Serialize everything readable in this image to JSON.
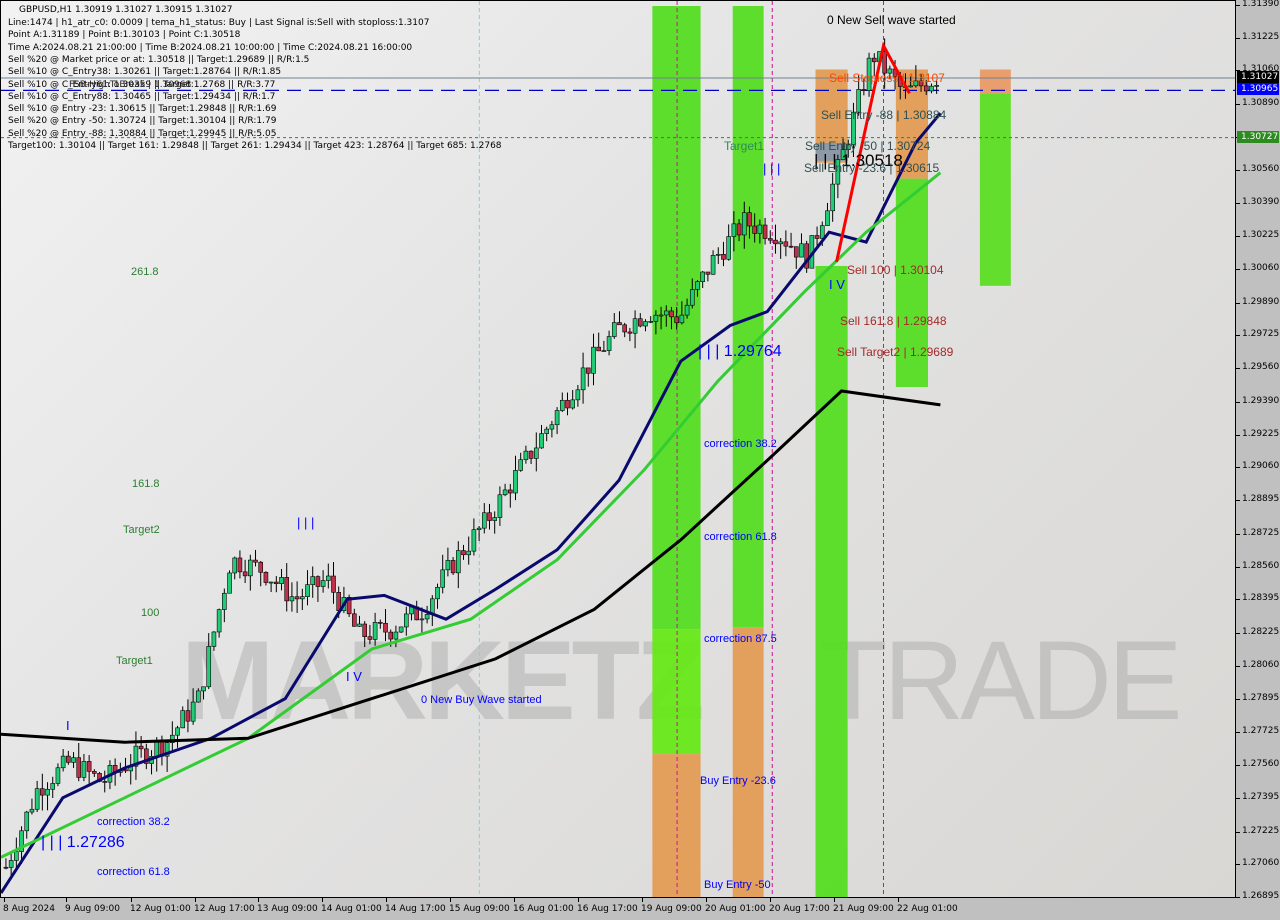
{
  "header": {
    "symbol_line": "GBPUSD,H1  1.30919 1.31027 1.30915 1.31027",
    "info_lines": [
      "Line:1474 | h1_atr_c0: 0.0009 | tema_h1_status: Buy | Last Signal is:Sell with stoploss:1.3107",
      "Point A:1.31189 | Point B:1.30103 | Point C:1.30518",
      "Time A:2024.08.21 21:00:00 | Time B:2024.08.21 10:00:00 | Time C:2024.08.21 16:00:00",
      "Sell %20 @ Market price or at: 1.30518 || Target:1.29689 || R/R:1.5",
      "Sell %10 @ C_Entry38: 1.30261 || Target:1.28764 || R/R:1.85",
      "Sell %10 @ C_Entry61: 1.30359 || Target:1.2768 || R/R:3.77",
      "Sell %10 @ C_Entry88: 1.30465 || Target:1.29434 || R/R:1.7",
      "Sell %10 @ Entry -23: 1.30615 || Target:1.29848 || R/R:1.69",
      "Sell %20 @ Entry -50: 1.30724 || Target:1.30104 || R/R:1.79",
      "Sell %20 @ Entry -88: 1.30884 || Target:1.29945 || R/R:5.05",
      "Target100: 1.30104 || Target 161: 1.29848 || Target 261: 1.29434 || Target 423: 1.28764 || Target 685: 1.2768"
    ],
    "overlay_text": "FSB-HighToBreak | 1.30968"
  },
  "watermark": {
    "left": "MARKETZ",
    "right": "TRADE"
  },
  "chart_data": {
    "type": "candlestick",
    "title": "GBPUSD,H1",
    "ohlc_last": {
      "open": 1.30919,
      "high": 1.31027,
      "low": 1.30915,
      "close": 1.31027
    },
    "ylim": [
      1.26895,
      1.3139
    ],
    "y_ticks": [
      "1.31390",
      "1.31225",
      "1.31060",
      "1.30890",
      "1.30727",
      "1.30560",
      "1.30390",
      "1.30225",
      "1.30060",
      "1.29890",
      "1.29725",
      "1.29560",
      "1.29390",
      "1.29225",
      "1.29060",
      "1.28895",
      "1.28725",
      "1.28560",
      "1.28395",
      "1.28225",
      "1.28060",
      "1.27895",
      "1.27725",
      "1.27560",
      "1.27395",
      "1.27225",
      "1.27060",
      "1.26895"
    ],
    "x_ticks": [
      "8 Aug 2024",
      "9 Aug 09:00",
      "12 Aug 01:00",
      "12 Aug 17:00",
      "13 Aug 09:00",
      "14 Aug 01:00",
      "14 Aug 17:00",
      "15 Aug 09:00",
      "16 Aug 01:00",
      "16 Aug 17:00",
      "19 Aug 09:00",
      "20 Aug 01:00",
      "20 Aug 17:00",
      "21 Aug 09:00",
      "22 Aug 01:00"
    ],
    "price_badges": [
      {
        "label": "1.31027",
        "value": 1.31027,
        "color": "#000000"
      },
      {
        "label": "1.30965",
        "value": 1.30965,
        "color": "#0000ff"
      },
      {
        "label": "1.30727",
        "value": 1.30727,
        "color": "#2e8b22"
      }
    ],
    "horizontal_lines": [
      {
        "name": "current-price",
        "value": 1.31027,
        "color": "#708090",
        "style": "solid"
      },
      {
        "name": "fsb-high-to-break",
        "value": 1.30965,
        "color": "#0000cc",
        "style": "dashed"
      },
      {
        "name": "level-130727",
        "value": 1.30727,
        "color": "#2e8b22",
        "style": "dotted"
      }
    ],
    "close_series_approx": [
      {
        "t": "8 Aug 2024",
        "v": 1.2705
      },
      {
        "t": "8 Aug 12:00",
        "v": 1.2745
      },
      {
        "t": "9 Aug 09:00",
        "v": 1.2758
      },
      {
        "t": "9 Aug 15:00",
        "v": 1.2748
      },
      {
        "t": "12 Aug 01:00",
        "v": 1.276
      },
      {
        "t": "12 Aug 17:00",
        "v": 1.2768
      },
      {
        "t": "13 Aug 01:00",
        "v": 1.279
      },
      {
        "t": "13 Aug 09:00",
        "v": 1.286
      },
      {
        "t": "13 Aug 17:00",
        "v": 1.2855
      },
      {
        "t": "14 Aug 01:00",
        "v": 1.284
      },
      {
        "t": "14 Aug 09:00",
        "v": 1.285
      },
      {
        "t": "14 Aug 17:00",
        "v": 1.2822
      },
      {
        "t": "15 Aug 01:00",
        "v": 1.2825
      },
      {
        "t": "15 Aug 09:00",
        "v": 1.2835
      },
      {
        "t": "15 Aug 17:00",
        "v": 1.286
      },
      {
        "t": "16 Aug 01:00",
        "v": 1.288
      },
      {
        "t": "16 Aug 09:00",
        "v": 1.2905
      },
      {
        "t": "16 Aug 17:00",
        "v": 1.293
      },
      {
        "t": "19 Aug 01:00",
        "v": 1.2955
      },
      {
        "t": "19 Aug 09:00",
        "v": 1.2975
      },
      {
        "t": "19 Aug 17:00",
        "v": 1.2985
      },
      {
        "t": "20 Aug 01:00",
        "v": 1.2982
      },
      {
        "t": "20 Aug 09:00",
        "v": 1.301
      },
      {
        "t": "20 Aug 17:00",
        "v": 1.303
      },
      {
        "t": "21 Aug 01:00",
        "v": 1.3025
      },
      {
        "t": "21 Aug 09:00",
        "v": 1.3012
      },
      {
        "t": "21 Aug 15:00",
        "v": 1.306
      },
      {
        "t": "21 Aug 21:00",
        "v": 1.3115
      },
      {
        "t": "22 Aug 01:00",
        "v": 1.3095
      },
      {
        "t": "22 Aug 05:00",
        "v": 1.3103
      }
    ],
    "ma_series": [
      {
        "name": "ma-fast-navy",
        "color": "#0a0a6e",
        "points": [
          [
            0,
            1.2692
          ],
          [
            0.05,
            1.274
          ],
          [
            0.1,
            1.2755
          ],
          [
            0.17,
            1.277
          ],
          [
            0.23,
            1.279
          ],
          [
            0.28,
            1.284
          ],
          [
            0.31,
            1.2842
          ],
          [
            0.36,
            1.283
          ],
          [
            0.4,
            1.2845
          ],
          [
            0.45,
            1.2865
          ],
          [
            0.5,
            1.29
          ],
          [
            0.55,
            1.296
          ],
          [
            0.59,
            1.2978
          ],
          [
            0.62,
            1.2985
          ],
          [
            0.67,
            1.3025
          ],
          [
            0.7,
            1.302
          ],
          [
            0.74,
            1.307
          ],
          [
            0.76,
            1.3085
          ]
        ]
      },
      {
        "name": "ma-mid-green",
        "color": "#33cc33",
        "points": [
          [
            0,
            1.271
          ],
          [
            0.1,
            1.274
          ],
          [
            0.2,
            1.277
          ],
          [
            0.3,
            1.2815
          ],
          [
            0.38,
            1.283
          ],
          [
            0.45,
            1.286
          ],
          [
            0.52,
            1.2905
          ],
          [
            0.58,
            1.295
          ],
          [
            0.65,
            1.2995
          ],
          [
            0.7,
            1.3025
          ],
          [
            0.76,
            1.3055
          ]
        ]
      },
      {
        "name": "ma-slow-black",
        "color": "#000000",
        "points": [
          [
            0,
            1.2772
          ],
          [
            0.1,
            1.2768
          ],
          [
            0.2,
            1.277
          ],
          [
            0.3,
            1.279
          ],
          [
            0.4,
            1.281
          ],
          [
            0.48,
            1.2835
          ],
          [
            0.55,
            1.287
          ],
          [
            0.62,
            1.291
          ],
          [
            0.68,
            1.2945
          ],
          [
            0.76,
            1.2938
          ]
        ]
      }
    ],
    "zones": [
      {
        "name": "green-zone-1",
        "x0": 0.527,
        "x1": 0.566,
        "y0": 1.3139,
        "y1": 1.2825,
        "color": "#55dd22"
      },
      {
        "name": "green-zone-1b",
        "x0": 0.527,
        "x1": 0.566,
        "y0": 1.2825,
        "y1": 1.2762,
        "color": "#66e818"
      },
      {
        "name": "orange-zone-1",
        "x0": 0.527,
        "x1": 0.566,
        "y0": 1.2762,
        "y1": 1.26895,
        "color": "#e39c55"
      },
      {
        "name": "green-zone-2",
        "x0": 0.592,
        "x1": 0.617,
        "y0": 1.3139,
        "y1": 1.2826,
        "color": "#55dd22"
      },
      {
        "name": "orange-zone-2",
        "x0": 0.592,
        "x1": 0.617,
        "y0": 1.2826,
        "y1": 1.26895,
        "color": "#e39c55"
      },
      {
        "name": "green-zone-3",
        "x0": 0.659,
        "x1": 0.685,
        "y0": 1.3008,
        "y1": 1.26895,
        "color": "#55dd22"
      },
      {
        "name": "orange-zone-3",
        "x0": 0.659,
        "x1": 0.685,
        "y0": 1.3107,
        "y1": 1.306,
        "color": "#e39c55"
      },
      {
        "name": "grey-zone-3",
        "x0": 0.659,
        "x1": 0.685,
        "y0": 1.307,
        "y1": 1.3061,
        "color": "#8899aa"
      },
      {
        "name": "orange-zone-4",
        "x0": 0.724,
        "x1": 0.75,
        "y0": 1.3107,
        "y1": 1.3052,
        "color": "#e39c55"
      },
      {
        "name": "green-zone-4",
        "x0": 0.724,
        "x1": 0.75,
        "y0": 1.3052,
        "y1": 1.2947,
        "color": "#55dd22"
      },
      {
        "name": "orange-zone-5",
        "x0": 0.792,
        "x1": 0.817,
        "y0": 1.3107,
        "y1": 1.3095,
        "color": "#e89a66"
      },
      {
        "name": "green-zone-5",
        "x0": 0.792,
        "x1": 0.817,
        "y0": 1.3095,
        "y1": 1.2998,
        "color": "#5cdd22"
      }
    ],
    "vlines": [
      {
        "x": 0.387,
        "color": "#88ccdd"
      },
      {
        "x": 0.547,
        "color": "#cc1199"
      },
      {
        "x": 0.624,
        "color": "#cc1199"
      },
      {
        "x": 0.714,
        "color": "#cc1199"
      }
    ],
    "annotations": [
      {
        "text": "0 New Sell wave started",
        "color": "#000000"
      },
      {
        "text": "Sell Stoploss | 1.3107",
        "color": "#ff4500"
      },
      {
        "text": "Sell Entry -88 | 1.30884",
        "color": "#2f4f4f"
      },
      {
        "text": "Sell Entry -50 | 1.30724",
        "color": "#2f4f4f"
      },
      {
        "text": "| | | 1.30518",
        "color": "#000000"
      },
      {
        "text": "Sell Entry -23.6 | 1.30615",
        "color": "#2f4f4f"
      },
      {
        "text": "Sell 100 | 1.30104",
        "color": "#a52a2a"
      },
      {
        "text": "Sell 161.8 | 1.29848",
        "color": "#a52a2a"
      },
      {
        "text": "Sell Target2 | 1.29689",
        "color": "#a52a2a"
      },
      {
        "text": "Target1",
        "color": "#2e8b57"
      },
      {
        "text": "| | |",
        "color": "#0000ff"
      },
      {
        "text": "I V",
        "color": "#0000ff"
      },
      {
        "text": "| | | 1.29764",
        "color": "#0000ff"
      },
      {
        "text": "correction 38.2",
        "color": "#0000ff"
      },
      {
        "text": "correction 61.8",
        "color": "#0000ff"
      },
      {
        "text": "correction 87.5",
        "color": "#0000ff"
      },
      {
        "text": "Buy Entry -23.6",
        "color": "#0000ff"
      },
      {
        "text": "Buy Entry -50",
        "color": "#0000ff"
      },
      {
        "text": "0 New Buy Wave started",
        "color": "#0000ff"
      },
      {
        "text": "| | |",
        "color": "#0000ff"
      },
      {
        "text": "I V",
        "color": "#0000ff"
      },
      {
        "text": "I",
        "color": "#0000ff"
      },
      {
        "text": "| | | 1.27286",
        "color": "#0000ff"
      },
      {
        "text": "correction 38.2",
        "color": "#0000ff"
      },
      {
        "text": "correction 61.8",
        "color": "#0000ff"
      },
      {
        "text": "261.8",
        "color": "#2e7d32"
      },
      {
        "text": "161.8",
        "color": "#2e7d32"
      },
      {
        "text": "Target2",
        "color": "#2e7d32"
      },
      {
        "text": "100",
        "color": "#2e7d32"
      },
      {
        "text": "Target1",
        "color": "#2e7d32"
      }
    ],
    "sell_wave_line": {
      "color": "#ff0000",
      "points": [
        [
          0.676,
          1.301
        ],
        [
          0.714,
          1.3119
        ],
        [
          0.735,
          1.3095
        ]
      ]
    }
  }
}
